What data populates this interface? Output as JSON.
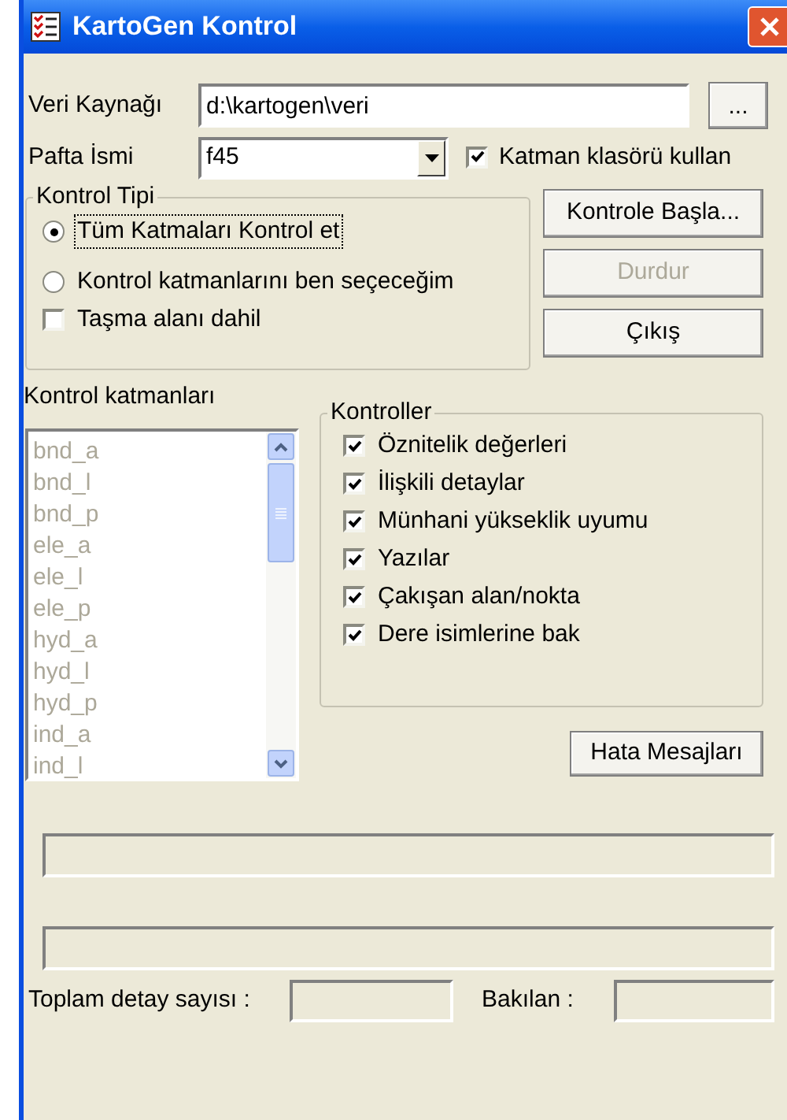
{
  "window": {
    "title": "KartoGen Kontrol"
  },
  "data_source": {
    "label": "Veri Kaynağı",
    "value": "d:\\kartogen\\veri",
    "browse_button": "..."
  },
  "sheet": {
    "label": "Pafta İsmi",
    "value": "f45"
  },
  "use_layer_folder": {
    "label": "Katman klasörü kullan",
    "checked": true
  },
  "control_type": {
    "title": "Kontrol Tipi",
    "options": [
      {
        "label": "Tüm Katmaları Kontrol et",
        "selected": true,
        "focused": true
      },
      {
        "label": "Kontrol katmanlarını ben seçeceğim",
        "selected": false,
        "focused": false
      }
    ]
  },
  "include_overflow": {
    "label": "Taşma alanı dahil",
    "checked": false
  },
  "buttons": [
    {
      "label": "Kontrole Başla...",
      "disabled": false
    },
    {
      "label": "Durdur",
      "disabled": true
    },
    {
      "label": "Çıkış",
      "disabled": false
    }
  ],
  "layers": {
    "label": "Kontrol katmanları",
    "disabled": true,
    "items": [
      "bnd_a",
      "bnd_l",
      "bnd_p",
      "ele_a",
      "ele_l",
      "ele_p",
      "hyd_a",
      "hyd_l",
      "hyd_p",
      "ind_a",
      "ind_l"
    ]
  },
  "checks": {
    "title": "Kontroller",
    "items": [
      {
        "label": "Öznitelik değerleri",
        "checked": true
      },
      {
        "label": "İlişkili detaylar",
        "checked": true
      },
      {
        "label": "Münhani yükseklik uyumu",
        "checked": true
      },
      {
        "label": "Yazılar",
        "checked": true
      },
      {
        "label": "Çakışan alan/nokta",
        "checked": true
      },
      {
        "label": "Dere isimlerine bak",
        "checked": true
      }
    ]
  },
  "error_button": "Hata Mesajları",
  "progress_bars": [
    {
      "level": 0
    },
    {
      "level": 0
    }
  ],
  "totals": {
    "total_label": "Toplam detay sayısı :",
    "checked_label": "Bakılan :"
  }
}
